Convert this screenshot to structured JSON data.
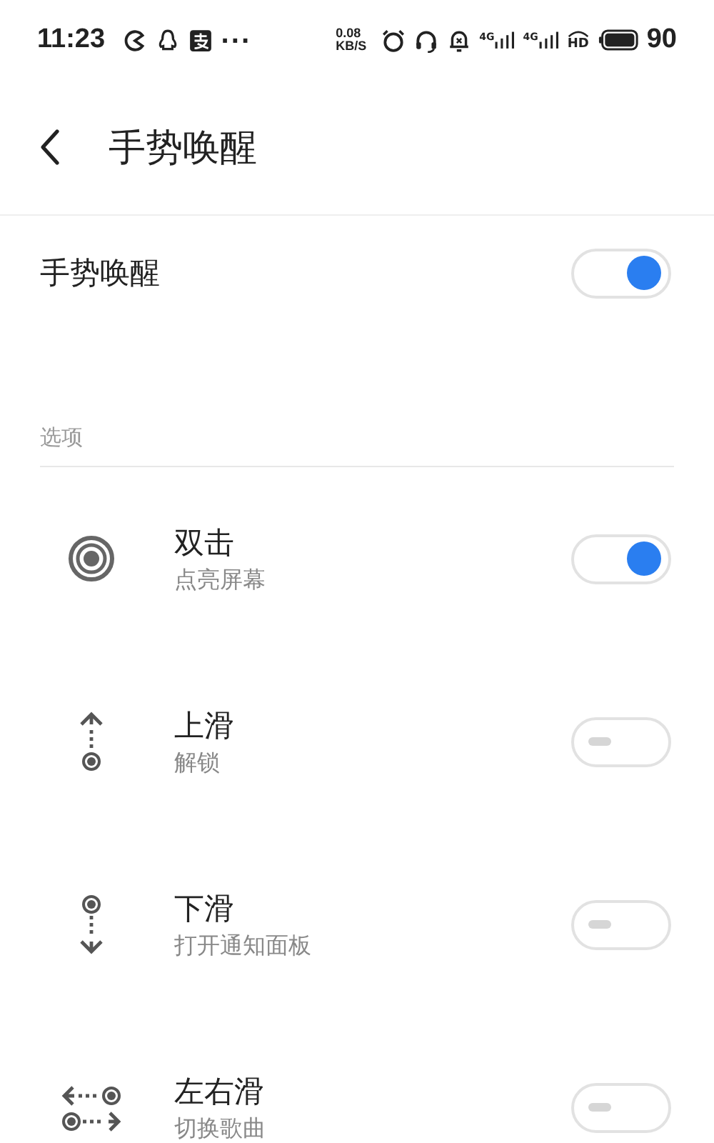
{
  "status_bar": {
    "time": "11:23",
    "more": "···",
    "net_speed": "0.08",
    "net_unit": "KB/S",
    "network_labels": [
      "4G",
      "4G"
    ],
    "hd": "HD",
    "battery": "90"
  },
  "header": {
    "title": "手势唤醒"
  },
  "master": {
    "label": "手势唤醒",
    "on": true
  },
  "section": {
    "title": "选项"
  },
  "gestures": [
    {
      "kind": "double-tap",
      "title": "双击",
      "subtitle": "点亮屏幕",
      "on": true
    },
    {
      "kind": "swipe-up",
      "title": "上滑",
      "subtitle": "解锁",
      "on": false
    },
    {
      "kind": "swipe-down",
      "title": "下滑",
      "subtitle": "打开通知面板",
      "on": false
    },
    {
      "kind": "swipe-sideways",
      "title": "左右滑",
      "subtitle": "切换歌曲",
      "on": false
    }
  ]
}
